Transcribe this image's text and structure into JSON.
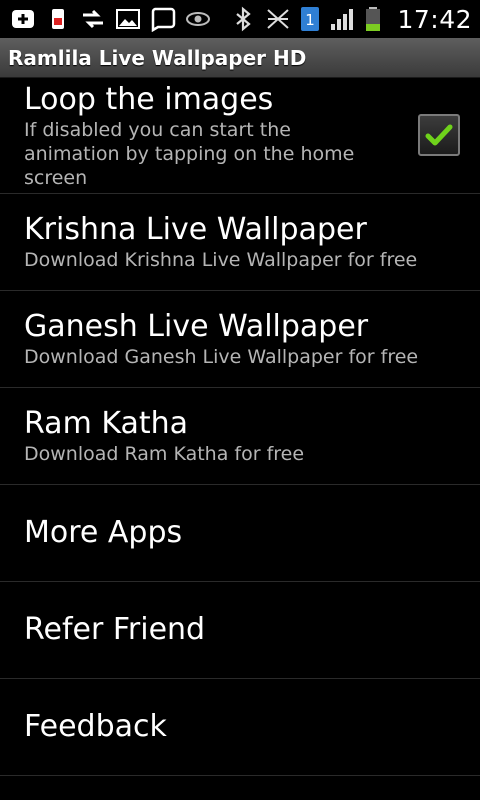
{
  "status_bar": {
    "time": "17:42",
    "notification_count": "1",
    "icons": [
      "usb-icon",
      "sim-warning-icon",
      "sync-arrows-icon",
      "image-icon",
      "chat-bubble-icon",
      "eye-icon",
      "bluetooth-icon",
      "no-signal-icon",
      "badge-icon",
      "signal-icon",
      "battery-icon"
    ],
    "colors": {
      "battery": "#7ccc22",
      "badge": "#2f7fd4"
    }
  },
  "title_bar": {
    "title": "Ramlila Live Wallpaper HD"
  },
  "settings": {
    "loop": {
      "title": "Loop the images",
      "subtitle": "If disabled you can start the animation by tapping on the home screen",
      "checked": true,
      "check_color": "#6fd21b"
    },
    "items": [
      {
        "title": "Krishna Live Wallpaper",
        "subtitle": "Download Krishna Live Wallpaper for free"
      },
      {
        "title": "Ganesh Live Wallpaper",
        "subtitle": "Download Ganesh Live Wallpaper for free"
      },
      {
        "title": "Ram Katha",
        "subtitle": "Download Ram Katha for free"
      },
      {
        "title": "More Apps"
      },
      {
        "title": "Refer Friend"
      },
      {
        "title": "Feedback"
      }
    ]
  }
}
